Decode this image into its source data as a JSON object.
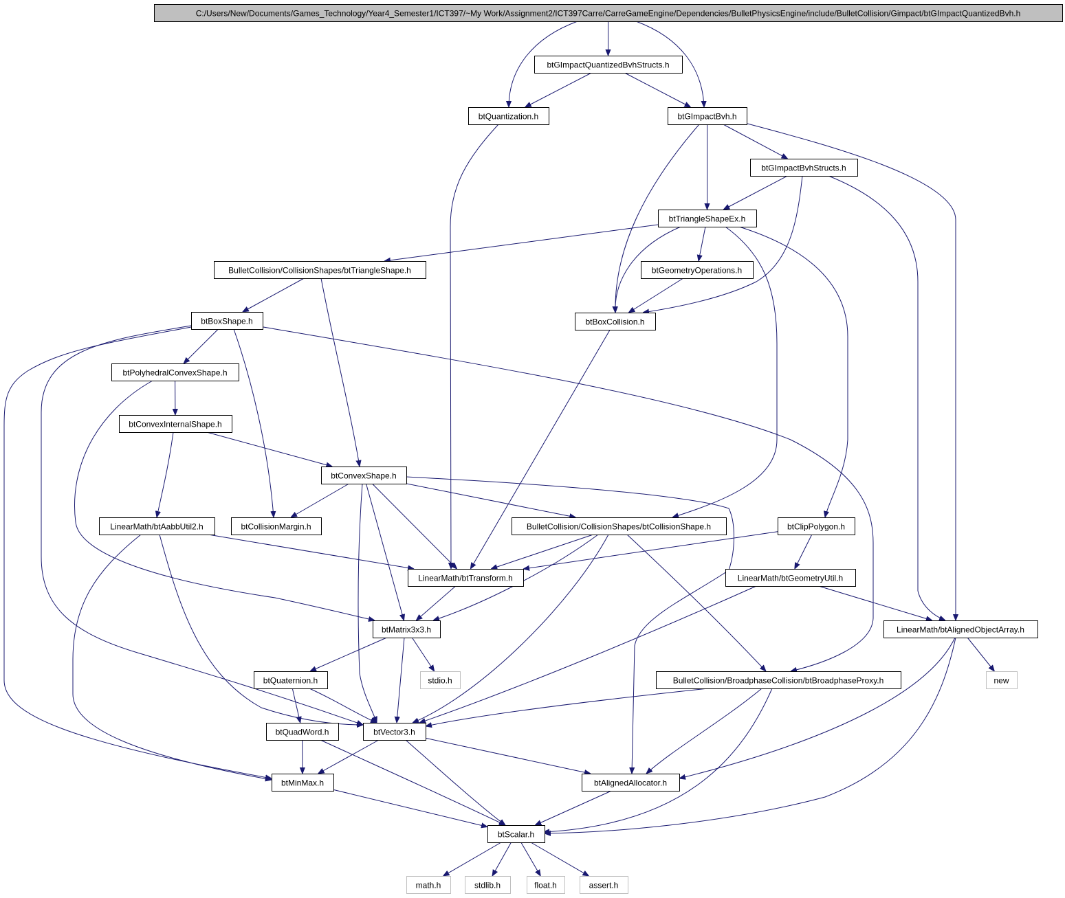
{
  "colors": {
    "edge": "#191970",
    "root_fill": "#bfbfbf",
    "node_border": "#000000",
    "external_border": "#bfbfbf"
  },
  "nodes": [
    {
      "id": "root",
      "label": "C:/Users/New/Documents/Games_Technology/Year4_Semester1/ICT397/~My Work/Assignment2/ICT397Carre/CarreGameEngine/Dependencies/BulletPhysicsEngine/include/BulletCollision/Gimpact/btGImpactQuantizedBvh.h",
      "kind": "root"
    },
    {
      "id": "qbvhstructs",
      "label": "btGImpactQuantizedBvhStructs.h",
      "kind": "file"
    },
    {
      "id": "quantization",
      "label": "btQuantization.h",
      "kind": "file"
    },
    {
      "id": "gimpactbvh",
      "label": "btGImpactBvh.h",
      "kind": "file"
    },
    {
      "id": "bvhstructs",
      "label": "btGImpactBvhStructs.h",
      "kind": "file"
    },
    {
      "id": "triex",
      "label": "btTriangleShapeEx.h",
      "kind": "file"
    },
    {
      "id": "trishape",
      "label": "BulletCollision/CollisionShapes/btTriangleShape.h",
      "kind": "file"
    },
    {
      "id": "geomops",
      "label": "btGeometryOperations.h",
      "kind": "file"
    },
    {
      "id": "boxcoll",
      "label": "btBoxCollision.h",
      "kind": "file"
    },
    {
      "id": "boxshape",
      "label": "btBoxShape.h",
      "kind": "file"
    },
    {
      "id": "polyconvex",
      "label": "btPolyhedralConvexShape.h",
      "kind": "file"
    },
    {
      "id": "convexint",
      "label": "btConvexInternalShape.h",
      "kind": "file"
    },
    {
      "id": "convexshape",
      "label": "btConvexShape.h",
      "kind": "file"
    },
    {
      "id": "aabbutil",
      "label": "LinearMath/btAabbUtil2.h",
      "kind": "file"
    },
    {
      "id": "collmargin",
      "label": "btCollisionMargin.h",
      "kind": "file"
    },
    {
      "id": "collshape",
      "label": "BulletCollision/CollisionShapes/btCollisionShape.h",
      "kind": "file"
    },
    {
      "id": "clippoly",
      "label": "btClipPolygon.h",
      "kind": "file"
    },
    {
      "id": "transform",
      "label": "LinearMath/btTransform.h",
      "kind": "file"
    },
    {
      "id": "geomutil",
      "label": "LinearMath/btGeometryUtil.h",
      "kind": "file"
    },
    {
      "id": "matrix",
      "label": "btMatrix3x3.h",
      "kind": "file"
    },
    {
      "id": "alignedarr",
      "label": "LinearMath/btAlignedObjectArray.h",
      "kind": "file"
    },
    {
      "id": "quaternion",
      "label": "btQuaternion.h",
      "kind": "file"
    },
    {
      "id": "stdio",
      "label": "stdio.h",
      "kind": "external"
    },
    {
      "id": "bpproxy",
      "label": "BulletCollision/BroadphaseCollision/btBroadphaseProxy.h",
      "kind": "file"
    },
    {
      "id": "new",
      "label": "new",
      "kind": "external"
    },
    {
      "id": "quadword",
      "label": "btQuadWord.h",
      "kind": "file"
    },
    {
      "id": "vector3",
      "label": "btVector3.h",
      "kind": "file"
    },
    {
      "id": "minmax",
      "label": "btMinMax.h",
      "kind": "file"
    },
    {
      "id": "alignedalloc",
      "label": "btAlignedAllocator.h",
      "kind": "file"
    },
    {
      "id": "scalar",
      "label": "btScalar.h",
      "kind": "file"
    },
    {
      "id": "math",
      "label": "math.h",
      "kind": "external"
    },
    {
      "id": "stdlib",
      "label": "stdlib.h",
      "kind": "external"
    },
    {
      "id": "float",
      "label": "float.h",
      "kind": "external"
    },
    {
      "id": "assert",
      "label": "assert.h",
      "kind": "external"
    }
  ],
  "edges": [
    {
      "from": "root",
      "to": "qbvhstructs"
    },
    {
      "from": "root",
      "to": "quantization"
    },
    {
      "from": "root",
      "to": "gimpactbvh"
    },
    {
      "from": "qbvhstructs",
      "to": "quantization"
    },
    {
      "from": "qbvhstructs",
      "to": "gimpactbvh"
    },
    {
      "from": "quantization",
      "to": "transform"
    },
    {
      "from": "gimpactbvh",
      "to": "bvhstructs"
    },
    {
      "from": "gimpactbvh",
      "to": "triex"
    },
    {
      "from": "gimpactbvh",
      "to": "boxcoll"
    },
    {
      "from": "gimpactbvh",
      "to": "alignedarr"
    },
    {
      "from": "bvhstructs",
      "to": "triex"
    },
    {
      "from": "bvhstructs",
      "to": "boxcoll"
    },
    {
      "from": "bvhstructs",
      "to": "alignedarr"
    },
    {
      "from": "triex",
      "to": "trishape"
    },
    {
      "from": "triex",
      "to": "geomops"
    },
    {
      "from": "triex",
      "to": "boxcoll"
    },
    {
      "from": "triex",
      "to": "collshape"
    },
    {
      "from": "triex",
      "to": "clippoly"
    },
    {
      "from": "geomops",
      "to": "boxcoll"
    },
    {
      "from": "boxcoll",
      "to": "transform"
    },
    {
      "from": "trishape",
      "to": "boxshape"
    },
    {
      "from": "trishape",
      "to": "convexshape"
    },
    {
      "from": "boxshape",
      "to": "polyconvex"
    },
    {
      "from": "boxshape",
      "to": "collmargin"
    },
    {
      "from": "boxshape",
      "to": "vector3"
    },
    {
      "from": "boxshape",
      "to": "minmax"
    },
    {
      "from": "boxshape",
      "to": "bpproxy"
    },
    {
      "from": "polyconvex",
      "to": "convexint"
    },
    {
      "from": "polyconvex",
      "to": "matrix"
    },
    {
      "from": "convexint",
      "to": "convexshape"
    },
    {
      "from": "convexint",
      "to": "aabbutil"
    },
    {
      "from": "convexshape",
      "to": "collmargin"
    },
    {
      "from": "convexshape",
      "to": "collshape"
    },
    {
      "from": "convexshape",
      "to": "transform"
    },
    {
      "from": "convexshape",
      "to": "matrix"
    },
    {
      "from": "convexshape",
      "to": "vector3"
    },
    {
      "from": "convexshape",
      "to": "alignedalloc"
    },
    {
      "from": "aabbutil",
      "to": "transform"
    },
    {
      "from": "aabbutil",
      "to": "vector3"
    },
    {
      "from": "aabbutil",
      "to": "minmax"
    },
    {
      "from": "collshape",
      "to": "transform"
    },
    {
      "from": "collshape",
      "to": "matrix"
    },
    {
      "from": "collshape",
      "to": "vector3"
    },
    {
      "from": "collshape",
      "to": "bpproxy"
    },
    {
      "from": "clippoly",
      "to": "transform"
    },
    {
      "from": "clippoly",
      "to": "geomutil"
    },
    {
      "from": "geomutil",
      "to": "alignedarr"
    },
    {
      "from": "geomutil",
      "to": "vector3"
    },
    {
      "from": "transform",
      "to": "matrix"
    },
    {
      "from": "matrix",
      "to": "quaternion"
    },
    {
      "from": "matrix",
      "to": "stdio"
    },
    {
      "from": "matrix",
      "to": "vector3"
    },
    {
      "from": "quaternion",
      "to": "quadword"
    },
    {
      "from": "quaternion",
      "to": "vector3"
    },
    {
      "from": "alignedarr",
      "to": "new"
    },
    {
      "from": "alignedarr",
      "to": "alignedalloc"
    },
    {
      "from": "alignedarr",
      "to": "scalar"
    },
    {
      "from": "bpproxy",
      "to": "vector3"
    },
    {
      "from": "bpproxy",
      "to": "alignedalloc"
    },
    {
      "from": "bpproxy",
      "to": "scalar"
    },
    {
      "from": "quadword",
      "to": "minmax"
    },
    {
      "from": "quadword",
      "to": "scalar"
    },
    {
      "from": "vector3",
      "to": "minmax"
    },
    {
      "from": "vector3",
      "to": "alignedalloc"
    },
    {
      "from": "vector3",
      "to": "scalar"
    },
    {
      "from": "minmax",
      "to": "scalar"
    },
    {
      "from": "alignedalloc",
      "to": "scalar"
    },
    {
      "from": "scalar",
      "to": "math"
    },
    {
      "from": "scalar",
      "to": "stdlib"
    },
    {
      "from": "scalar",
      "to": "float"
    },
    {
      "from": "scalar",
      "to": "assert"
    }
  ]
}
